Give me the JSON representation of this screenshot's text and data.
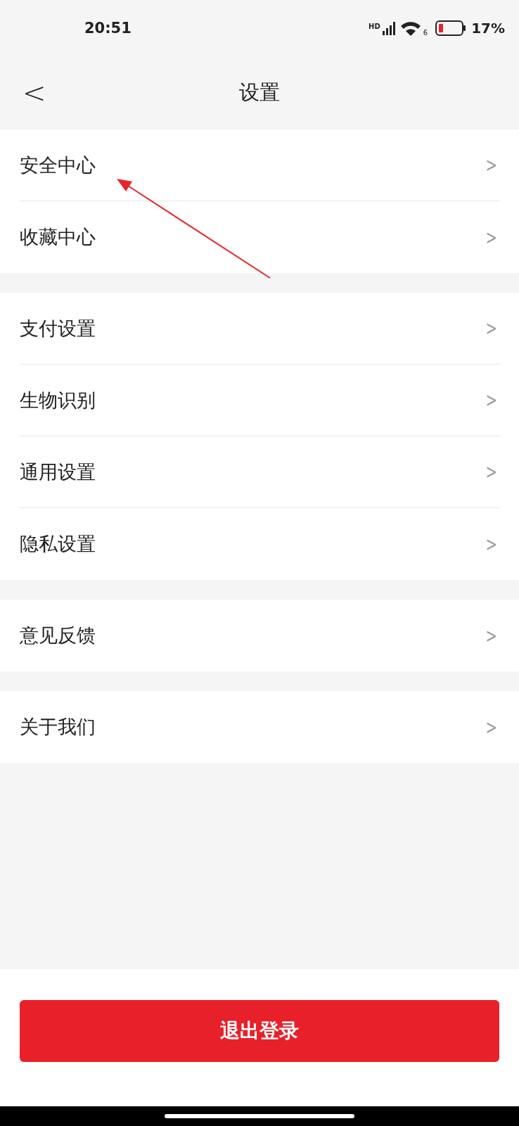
{
  "status_bar": {
    "time": "20:51",
    "network_badge": "HD",
    "wifi_badge": "6",
    "battery": "17%"
  },
  "header": {
    "back": "<",
    "title": "设置"
  },
  "groups": [
    {
      "items": [
        {
          "label": "安全中心",
          "chevron": ">"
        },
        {
          "label": "收藏中心",
          "chevron": ">"
        }
      ]
    },
    {
      "items": [
        {
          "label": "支付设置",
          "chevron": ">"
        },
        {
          "label": "生物识别",
          "chevron": ">"
        },
        {
          "label": "通用设置",
          "chevron": ">"
        },
        {
          "label": "隐私设置",
          "chevron": ">"
        }
      ]
    },
    {
      "items": [
        {
          "label": "意见反馈",
          "chevron": ">"
        }
      ]
    },
    {
      "items": [
        {
          "label": "关于我们",
          "chevron": ">"
        }
      ]
    }
  ],
  "logout_button": "退出登录"
}
